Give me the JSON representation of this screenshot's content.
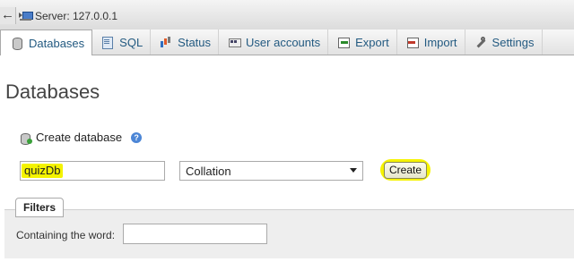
{
  "topbar": {
    "server_label": "Server: 127.0.0.1"
  },
  "tabs": [
    {
      "label": "Databases",
      "icon": "database-icon",
      "active": true
    },
    {
      "label": "SQL",
      "icon": "sql-icon"
    },
    {
      "label": "Status",
      "icon": "status-icon"
    },
    {
      "label": "User accounts",
      "icon": "user-accounts-icon"
    },
    {
      "label": "Export",
      "icon": "export-icon"
    },
    {
      "label": "Import",
      "icon": "import-icon"
    },
    {
      "label": "Settings",
      "icon": "settings-icon"
    }
  ],
  "page": {
    "title": "Databases"
  },
  "create_db": {
    "heading": "Create database",
    "help_glyph": "?",
    "name_value": "quizDb",
    "collation_value": "Collation",
    "create_label": "Create",
    "highlight_color": "#f4f300"
  },
  "filters": {
    "tab_label": "Filters",
    "contains_label": "Containing the word:",
    "contains_value": ""
  }
}
